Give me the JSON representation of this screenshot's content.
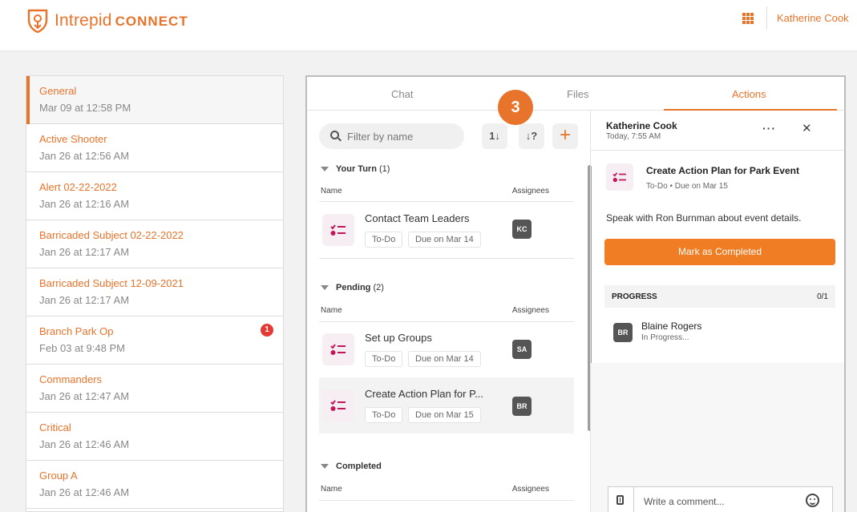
{
  "header": {
    "brand": "Intrepid",
    "brand_suffix": "CONNECT",
    "user_name": "Katherine Cook",
    "accent_color": "#e8732a",
    "apps_icon": "grid-icon"
  },
  "conversations": [
    {
      "title": "General",
      "date": "Mar 09 at 12:58 PM",
      "active": true
    },
    {
      "title": "Active Shooter",
      "date": "Jan 26 at 12:56 AM"
    },
    {
      "title": "Alert 02-22-2022",
      "date": "Jan 26 at 12:16 AM"
    },
    {
      "title": "Barricaded Subject 02-22-2022",
      "date": "Jan 26 at 12:17 AM"
    },
    {
      "title": "Barricaded Subject 12-09-2021",
      "date": "Jan 26 at 12:17 AM"
    },
    {
      "title": "Branch Park Op",
      "date": "Feb 03 at 9:48 PM",
      "badge": "1"
    },
    {
      "title": "Commanders",
      "date": "Jan 26 at 12:47 AM"
    },
    {
      "title": "Critical",
      "date": "Jan 26 at 12:46 AM"
    },
    {
      "title": "Group A",
      "date": "Jan 26 at 12:46 AM"
    }
  ],
  "tabs": {
    "chat": "Chat",
    "files": "Files",
    "actions": "Actions"
  },
  "step_marker": "3",
  "actions_list": {
    "search_placeholder": "Filter by name",
    "sort_icon": "sort-icon",
    "filter_icon": "filter-icon",
    "add_label": "+",
    "sort_label": "1↓",
    "filter_label": "↓?",
    "column_name": "Name",
    "column_assignees": "Assignees",
    "your_turn": {
      "title": "Your Turn",
      "count": "(1)"
    },
    "pending": {
      "title": "Pending",
      "count": "(2)"
    },
    "completed": {
      "title": "Completed"
    },
    "tasks": [
      {
        "title": "Contact Team Leaders",
        "status": "To-Do",
        "due": "Due on Mar 14",
        "assignee": "KC"
      },
      {
        "title": "Set up Groups",
        "status": "To-Do",
        "due": "Due on Mar 14",
        "assignee": "SA"
      },
      {
        "title": "Create Action Plan for P...",
        "status": "To-Do",
        "due": "Due on Mar 15",
        "assignee": "BR"
      }
    ]
  },
  "detail": {
    "author": "Katherine Cook",
    "time": "Today, 7:55 AM",
    "more_label": "···",
    "close_label": "✕",
    "task_title": "Create Action Plan for Park Event",
    "task_sub": "To-Do • Due on Mar 15",
    "description": "Speak with Ron Burnman about event details.",
    "complete_button": "Mark as Completed",
    "progress_label": "PROGRESS",
    "progress_count": "0/1",
    "assignee_initials": "BR",
    "assignee_name": "Blaine Rogers",
    "assignee_status": "In Progress...",
    "comment_placeholder": "Write a comment..."
  }
}
